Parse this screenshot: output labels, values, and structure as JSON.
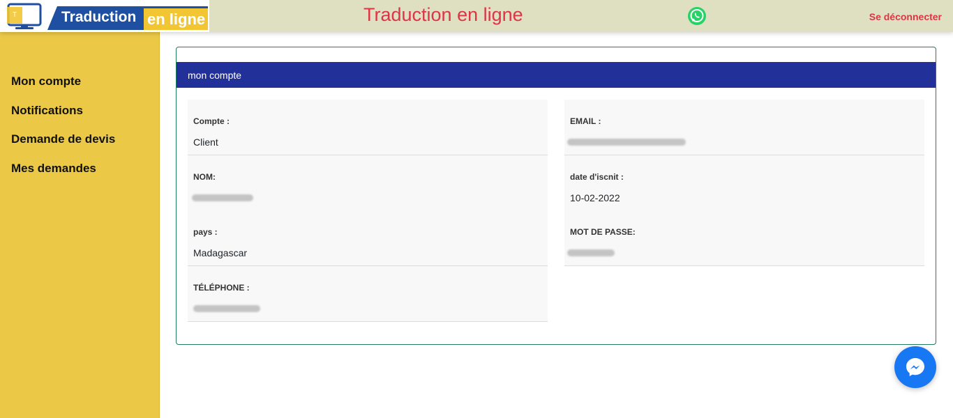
{
  "header": {
    "logo_word_1": "Traduction",
    "logo_word_2": "en ligne",
    "title": "Traduction en ligne",
    "whatsapp_icon": "whatsapp-icon",
    "logout_label": "Se déconnecter"
  },
  "sidebar": {
    "items": [
      {
        "label": "Mon compte"
      },
      {
        "label": "Notifications"
      },
      {
        "label": "Demande de devis"
      },
      {
        "label": "Mes demandes"
      }
    ]
  },
  "card": {
    "header": "mon compte",
    "left": [
      {
        "label": "Compte :",
        "value": "Client"
      },
      {
        "label": "NOM:",
        "value": ""
      },
      {
        "label": "pays :",
        "value": "Madagascar"
      },
      {
        "label": "TÉLÉPHONE :",
        "value": ""
      }
    ],
    "right": [
      {
        "label": "EMAIL :",
        "value": ""
      },
      {
        "label": "date d'iscnit :",
        "value": "10-02-2022"
      },
      {
        "label": "MOT DE PASSE:",
        "value": ""
      }
    ]
  },
  "messenger_icon": "messenger-icon",
  "colors": {
    "topbar": "#dfdfc2",
    "title_red": "#dc3545",
    "sidebar_yellow": "#ebc947",
    "card_header_blue": "#22309a",
    "card_border_green": "#1e7d5a",
    "messenger_blue": "#1877f2"
  }
}
